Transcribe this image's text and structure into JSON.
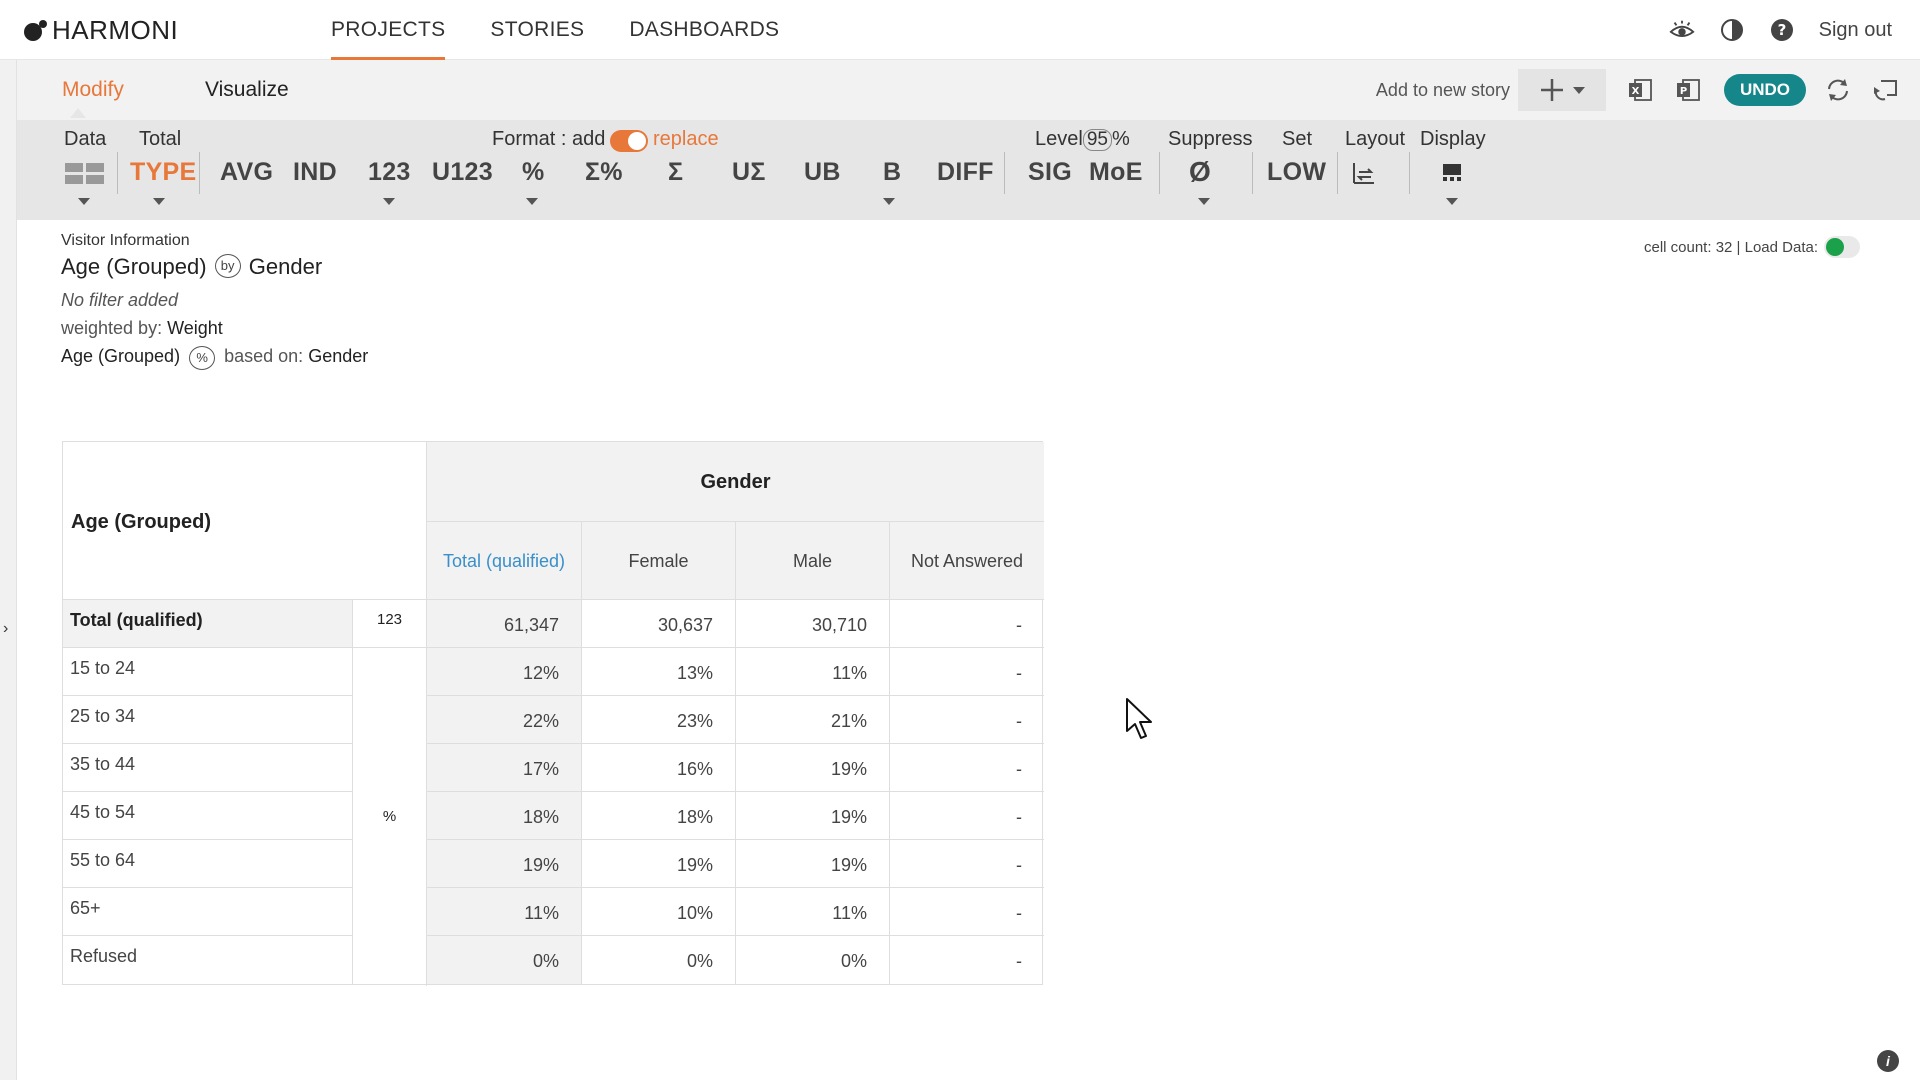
{
  "app": {
    "logo_text": "HARMONI"
  },
  "nav": {
    "tabs": [
      {
        "label": "PROJECTS",
        "active": true
      },
      {
        "label": "STORIES",
        "active": false
      },
      {
        "label": "DASHBOARDS",
        "active": false
      }
    ],
    "signout_label": "Sign out",
    "accent_color": "#e8773a"
  },
  "subbar": {
    "modify_label": "Modify",
    "visualize_label": "Visualize",
    "add_to_story_label": "Add to new story",
    "undo_label": "UNDO"
  },
  "toolbar": {
    "data_label": "Data",
    "total_label": "Total",
    "format_label": "Format : add",
    "replace_label": "replace",
    "level_label": "Level",
    "level_value": "95",
    "level_suffix": "%",
    "suppress_label": "Suppress",
    "set_label": "Set",
    "layout_label": "Layout",
    "display_label": "Display",
    "buttons": {
      "type": "TYPE",
      "avg": "AVG",
      "ind": "IND",
      "n123": "123",
      "u123": "U123",
      "pct": "%",
      "sigma_pct": "Σ%",
      "sigma": "Σ",
      "u_sigma": "UΣ",
      "ub": "UB",
      "b": "B",
      "diff": "DIFF",
      "sig": "SIG",
      "moe": "MoE",
      "suppress_symbol": "Ø",
      "low": "LOW"
    }
  },
  "info": {
    "dataset": "Visitor Information",
    "row_var": "Age (Grouped)",
    "by_icon_text": "by",
    "col_var": "Gender",
    "filter": "No filter added",
    "weighted_prefix": "weighted by:",
    "weight": "Weight",
    "pct_var": "Age (Grouped)",
    "pct_icon_text": "%",
    "based_prefix": "based on:",
    "based_var": "Gender",
    "cell_count": "cell count: 32 | Load Data:"
  },
  "table": {
    "row_header": "Age (Grouped)",
    "col_group": "Gender",
    "columns": [
      "Total (qualified)",
      "Female",
      "Male",
      "Not Answered"
    ],
    "total_row": {
      "label": "Total (qualified)",
      "stat": "123",
      "values": [
        "61,347",
        "30,637",
        "30,710",
        "-"
      ]
    },
    "pct_stat": "%",
    "rows": [
      {
        "label": "15 to 24",
        "values": [
          "12%",
          "13%",
          "11%",
          "-"
        ]
      },
      {
        "label": "25 to 34",
        "values": [
          "22%",
          "23%",
          "21%",
          "-"
        ]
      },
      {
        "label": "35 to 44",
        "values": [
          "17%",
          "16%",
          "19%",
          "-"
        ]
      },
      {
        "label": "45 to 54",
        "values": [
          "18%",
          "18%",
          "19%",
          "-"
        ]
      },
      {
        "label": "55 to 64",
        "values": [
          "19%",
          "19%",
          "19%",
          "-"
        ]
      },
      {
        "label": "65+",
        "values": [
          "11%",
          "10%",
          "11%",
          "-"
        ]
      },
      {
        "label": "Refused",
        "values": [
          "0%",
          "0%",
          "0%",
          "-"
        ]
      }
    ]
  },
  "footer": {
    "info_icon_text": "i"
  }
}
